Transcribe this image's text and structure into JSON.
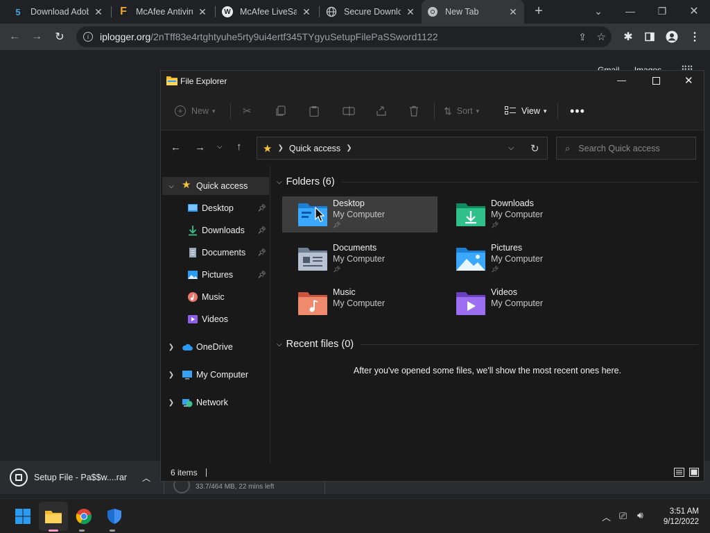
{
  "browser": {
    "tabs": [
      {
        "label": "Download Adob",
        "fav": "5",
        "fav_color": "#4aa3df"
      },
      {
        "label": "McAfee Antiviru",
        "fav": "F",
        "fav_color": "#f5a623"
      },
      {
        "label": "McAfee LiveSafe",
        "fav": "W",
        "fav_color": "#e8eaed"
      },
      {
        "label": "Secure Downloa",
        "fav": "",
        "fav_color": "#bdc1c6"
      },
      {
        "label": "New Tab",
        "fav": "",
        "fav_color": "#bdc1c6"
      }
    ],
    "url_host": "iplogger.org",
    "url_path": "/2nTff83e4rtghtyuhe5rty9ui4ertf345TYgyuSetupFilePaSSword1122",
    "page_links": {
      "gmail": "Gmail",
      "images": "Images"
    }
  },
  "download": {
    "file_name": "Setup File - Pa$$w....rar",
    "progress_text": "33.7/464 MB, 22 mins left"
  },
  "explorer": {
    "title": "File Explorer",
    "toolbar": {
      "new": "New",
      "sort": "Sort",
      "view": "View"
    },
    "breadcrumb": "Quick access",
    "search_placeholder": "Search Quick access",
    "nav": [
      {
        "label": "Quick access"
      },
      {
        "label": "Desktop",
        "pinned": true
      },
      {
        "label": "Downloads",
        "pinned": true
      },
      {
        "label": "Documents",
        "pinned": true
      },
      {
        "label": "Pictures",
        "pinned": true
      },
      {
        "label": "Music"
      },
      {
        "label": "Videos"
      },
      {
        "label": "OneDrive"
      },
      {
        "label": "My Computer"
      },
      {
        "label": "Network"
      }
    ],
    "folders_header": "Folders (6)",
    "folders": [
      {
        "name": "Desktop",
        "location": "My Computer",
        "pinned": true
      },
      {
        "name": "Downloads",
        "location": "My Computer",
        "pinned": true
      },
      {
        "name": "Documents",
        "location": "My Computer",
        "pinned": true
      },
      {
        "name": "Pictures",
        "location": "My Computer",
        "pinned": true
      },
      {
        "name": "Music",
        "location": "My Computer",
        "pinned": false
      },
      {
        "name": "Videos",
        "location": "My Computer",
        "pinned": false
      }
    ],
    "recent_header": "Recent files (0)",
    "recent_empty": "After you've opened some files, we'll show the most recent ones here.",
    "status": "6 items"
  },
  "taskbar": {
    "time": "3:51 AM",
    "date": "9/12/2022"
  },
  "colors": {
    "accent": "#0078d4",
    "selection": "#3d3d3d",
    "star": "#f7c53b"
  }
}
